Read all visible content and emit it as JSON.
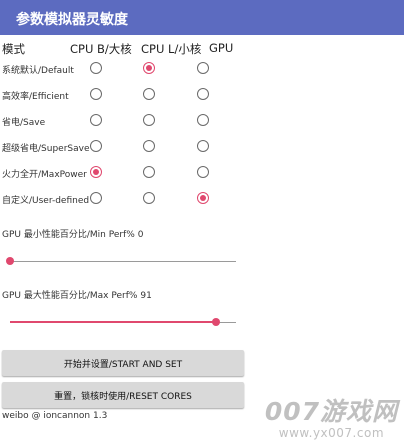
{
  "appbar": {
    "title": "参数模拟器灵敏度"
  },
  "grid": {
    "mode_header": "模式",
    "columns": [
      "CPU B/大核",
      "CPU L/小核",
      "GPU"
    ],
    "rows": [
      {
        "label": "系统默认/Default",
        "selected": "CPU L/小核"
      },
      {
        "label": "高效率/Efficient",
        "selected": ""
      },
      {
        "label": "省电/Save",
        "selected": ""
      },
      {
        "label": "超级省电/SuperSave",
        "selected": ""
      },
      {
        "label": "火力全开/MaxPower",
        "selected": "CPU B/大核"
      },
      {
        "label": "自定义/User-defined",
        "selected": "GPU"
      }
    ]
  },
  "gpu_min": {
    "label": "GPU 最小性能百分比/Min Perf%",
    "value": "0",
    "fraction": 0.0
  },
  "gpu_max": {
    "label": "GPU 最大性能百分比/Max Perf%",
    "value": "91",
    "fraction": 0.91
  },
  "buttons": {
    "start": "开始并设置/START AND SET",
    "reset": "重置，锁核时使用/RESET CORES"
  },
  "footer": "weibo @ ioncannon 1.3",
  "watermark": {
    "main": "007游戏网",
    "sub": "www.yx007.com"
  },
  "colors": {
    "appbar": "#5c6bc0",
    "accent": "#e0486e",
    "button": "#d9d9d9"
  }
}
